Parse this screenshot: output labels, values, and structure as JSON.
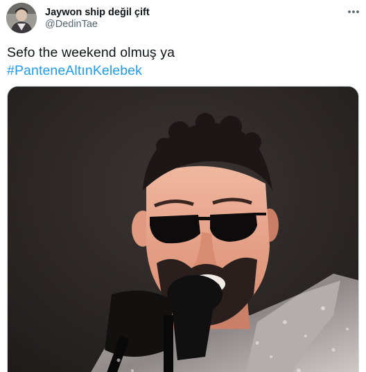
{
  "tweet": {
    "author": {
      "display_name": "Jaywon ship değil çift",
      "handle": "@DedinTae"
    },
    "text": "Sefo the weekend olmuş ya",
    "hashtag": "#PanteneAltınKelebek",
    "more_icon": "more-horizontal-icon"
  }
}
